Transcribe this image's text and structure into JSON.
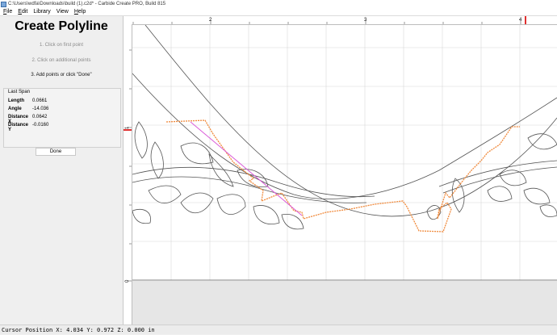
{
  "window": {
    "title": "C:\\Users\\wdfa\\Downloads\\build (1).c2d* - Carbide Create PRO, Build 815"
  },
  "menu": [
    {
      "accel": "F",
      "rest": "ile"
    },
    {
      "accel": "E",
      "rest": "dit"
    },
    {
      "accel": "",
      "rest": "Library"
    },
    {
      "accel": "",
      "rest": "View"
    },
    {
      "accel": "H",
      "rest": "elp"
    }
  ],
  "panel": {
    "title": "Create Polyline",
    "steps": [
      "1. Click on first point",
      "2. Click on additional points",
      "3. Add points or click \"Done\""
    ],
    "last_span": {
      "title": "Last Span",
      "rows": [
        {
          "label": "Length",
          "value": "0.0661"
        },
        {
          "label": "Angle",
          "value": "-14.036"
        },
        {
          "label": "Distance X",
          "value": "0.0642"
        },
        {
          "label": "Distance Y",
          "value": "-0.0160"
        }
      ]
    },
    "done_label": "Done"
  },
  "rulers": {
    "top_labels": [
      "2",
      "3",
      "4"
    ],
    "left_labels": [
      "1",
      "0"
    ],
    "accent": "#e03030"
  },
  "status": {
    "text": "Cursor Position X: 4.034 Y: 0.972 Z: 0.000 in"
  },
  "colors": {
    "polyline": "#f08a3c",
    "preview": "#d958d9",
    "geometry": "#555555",
    "grid": "#d8d8d8"
  }
}
